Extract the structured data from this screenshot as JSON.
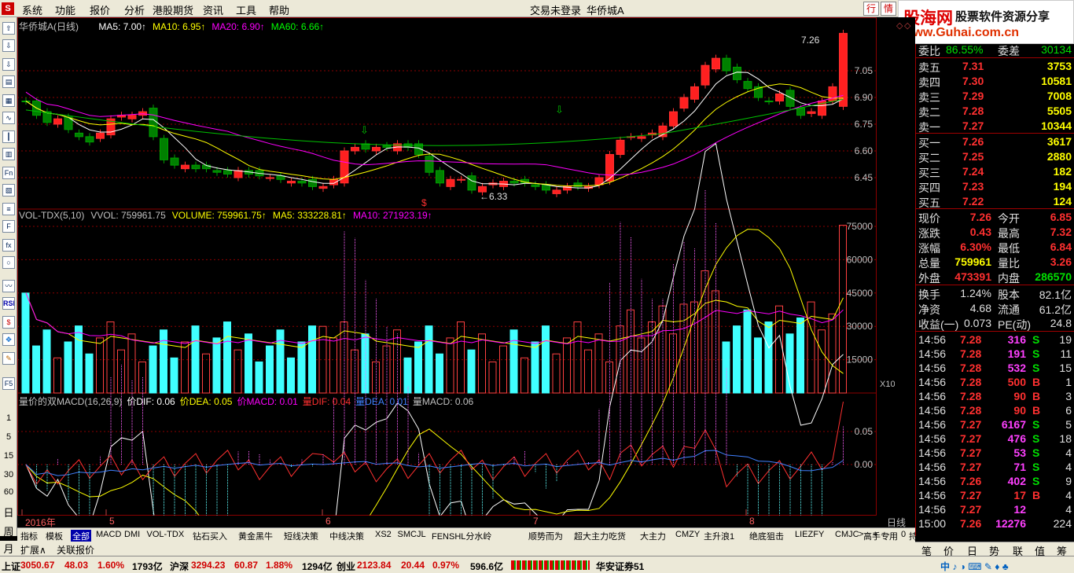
{
  "menu": {
    "items": [
      "系统",
      "功能",
      "报价",
      "分析",
      "港股期货",
      "资讯",
      "工具",
      "帮助"
    ],
    "trade_status": "交易未登录",
    "stock_title": "华侨城A",
    "btn_market": "行",
    "btn_info": "情"
  },
  "brand": {
    "name": "股海网",
    "slogan": "股票软件资源分享",
    "url": "www.Guhai.com.cn"
  },
  "toolbar": {
    "periods": [
      "1",
      "5",
      "15",
      "30",
      "60",
      "日",
      "周",
      "月"
    ],
    "rsi": "RSI",
    "fs": "F5"
  },
  "kline": {
    "title": "华侨城A(日线)",
    "ma_labels": [
      {
        "text": "MA5: 7.00",
        "color": "#ffffff"
      },
      {
        "text": "MA10: 6.95",
        "color": "#ffff00"
      },
      {
        "text": "MA20: 6.90",
        "color": "#ff00ff"
      },
      {
        "text": "MA60: 6.66",
        "color": "#00ff00"
      }
    ],
    "high_marker": "7.26",
    "low_marker": "6.33",
    "price_ticks": [
      "7.05",
      "6.90",
      "6.75",
      "6.60",
      "6.45"
    ]
  },
  "volume": {
    "labels": [
      {
        "text": "VOL-TDX(5,10)",
        "color": "#c0c0c0"
      },
      {
        "text": "VVOL: 759961.75",
        "color": "#c0c0c0"
      },
      {
        "text": "VOLUME: 759961.75",
        "color": "#ffff00"
      },
      {
        "text": "MA5: 333228.81",
        "color": "#ffff00"
      },
      {
        "text": "MA10: 271923.19",
        "color": "#ff00ff"
      }
    ],
    "ticks": [
      "75000",
      "60000",
      "45000",
      "30000",
      "15000"
    ],
    "unit": "X10"
  },
  "macd": {
    "labels": [
      {
        "text": "量价的双MACD(16,26,9)",
        "color": "#c0c0c0"
      },
      {
        "text": "价DIF: 0.06",
        "color": "#ffffff"
      },
      {
        "text": "价DEA: 0.05",
        "color": "#ffff00"
      },
      {
        "text": "价MACD: 0.01",
        "color": "#ff00ff"
      },
      {
        "text": "量DIF: 0.04",
        "color": "#ff3030"
      },
      {
        "text": "量DEA: 0.01",
        "color": "#4080ff"
      },
      {
        "text": "量MACD: 0.06",
        "color": "#c0c0c0"
      }
    ],
    "ticks": [
      "0.05",
      "0.00"
    ]
  },
  "date_axis": {
    "labels": [
      "2016年",
      "5",
      "6",
      "7",
      "8"
    ],
    "period": "日线"
  },
  "bottom_tabs": [
    "指标",
    "模板",
    "全部",
    "MACD",
    "DMI",
    "VOL-TDX",
    "钻石买入",
    "黄金黑牛",
    "短线决策",
    "中线决策",
    "XS2",
    "SMCJL",
    "FENSHL分水岭",
    "顺势而为",
    "超大主力吃货",
    "大主力",
    "CMZY",
    "主升浪1",
    "绝底狙击",
    "LIEZFY",
    "CMJC",
    "高手专用",
    "持仓线"
  ],
  "ext_tabs": [
    "扩展∧",
    "关联报价"
  ],
  "quote": {
    "committee": {
      "ratio_label": "委比",
      "ratio": "86.55%",
      "diff_label": "委差",
      "diff": "30134"
    },
    "asks": [
      {
        "label": "卖五",
        "price": "7.31",
        "vol": "3753"
      },
      {
        "label": "卖四",
        "price": "7.30",
        "vol": "10581"
      },
      {
        "label": "卖三",
        "price": "7.29",
        "vol": "7008"
      },
      {
        "label": "卖二",
        "price": "7.28",
        "vol": "5505"
      },
      {
        "label": "卖一",
        "price": "7.27",
        "vol": "10344"
      }
    ],
    "bids": [
      {
        "label": "买一",
        "price": "7.26",
        "vol": "3617"
      },
      {
        "label": "买二",
        "price": "7.25",
        "vol": "2880"
      },
      {
        "label": "买三",
        "price": "7.24",
        "vol": "182"
      },
      {
        "label": "买四",
        "price": "7.23",
        "vol": "194"
      },
      {
        "label": "买五",
        "price": "7.22",
        "vol": "124"
      }
    ],
    "stats": [
      {
        "l1": "现价",
        "v1": "7.26",
        "c1": "#ff3030",
        "l2": "今开",
        "v2": "6.85",
        "c2": "#ff3030"
      },
      {
        "l1": "涨跌",
        "v1": "0.43",
        "c1": "#ff3030",
        "l2": "最高",
        "v2": "7.32",
        "c2": "#ff3030"
      },
      {
        "l1": "涨幅",
        "v1": "6.30%",
        "c1": "#ff3030",
        "l2": "最低",
        "v2": "6.84",
        "c2": "#ff3030"
      },
      {
        "l1": "总量",
        "v1": "759961",
        "c1": "#ffff00",
        "l2": "量比",
        "v2": "3.26",
        "c2": "#ff3030"
      },
      {
        "l1": "外盘",
        "v1": "473391",
        "c1": "#ff3030",
        "l2": "内盘",
        "v2": "286570",
        "c2": "#00e000"
      }
    ],
    "stats2": [
      {
        "l1": "换手",
        "v1": "1.24%",
        "c1": "#e0e0e0",
        "l2": "股本",
        "v2": "82.1亿",
        "c2": "#e0e0e0"
      },
      {
        "l1": "净资",
        "v1": "4.68",
        "c1": "#e0e0e0",
        "l2": "流通",
        "v2": "61.2亿",
        "c2": "#e0e0e0"
      },
      {
        "l1": "收益(一)",
        "v1": "0.073",
        "c1": "#e0e0e0",
        "l2": "PE(动)",
        "v2": "24.8",
        "c2": "#e0e0e0"
      }
    ],
    "ticks": [
      {
        "t": "14:56",
        "p": "7.28",
        "v": "316",
        "bs": "S",
        "n": "19"
      },
      {
        "t": "14:56",
        "p": "7.28",
        "v": "191",
        "bs": "S",
        "n": "11"
      },
      {
        "t": "14:56",
        "p": "7.28",
        "v": "532",
        "bs": "S",
        "n": "15"
      },
      {
        "t": "14:56",
        "p": "7.28",
        "v": "500",
        "bs": "B",
        "n": "1"
      },
      {
        "t": "14:56",
        "p": "7.28",
        "v": "90",
        "bs": "B",
        "n": "3"
      },
      {
        "t": "14:56",
        "p": "7.28",
        "v": "90",
        "bs": "B",
        "n": "6"
      },
      {
        "t": "14:56",
        "p": "7.27",
        "v": "6167",
        "bs": "S",
        "n": "5"
      },
      {
        "t": "14:56",
        "p": "7.27",
        "v": "476",
        "bs": "S",
        "n": "18"
      },
      {
        "t": "14:56",
        "p": "7.27",
        "v": "53",
        "bs": "S",
        "n": "4"
      },
      {
        "t": "14:56",
        "p": "7.27",
        "v": "71",
        "bs": "S",
        "n": "4"
      },
      {
        "t": "14:56",
        "p": "7.26",
        "v": "402",
        "bs": "S",
        "n": "9"
      },
      {
        "t": "14:56",
        "p": "7.27",
        "v": "17",
        "bs": "B",
        "n": "4"
      },
      {
        "t": "14:56",
        "p": "7.27",
        "v": "12",
        "bs": "",
        "n": "4"
      },
      {
        "t": "15:00",
        "p": "7.26",
        "v": "12276",
        "bs": "",
        "n": "224"
      }
    ]
  },
  "panel_tabs": [
    "笔",
    "价",
    "日",
    "势",
    "联",
    "值",
    "筹"
  ],
  "statusbar": [
    {
      "text": "上证",
      "color": "#000"
    },
    {
      "text": "3050.67",
      "color": "#d00000"
    },
    {
      "text": "48.03",
      "color": "#d00000"
    },
    {
      "text": "1.60%",
      "color": "#d00000"
    },
    {
      "text": "1793亿",
      "color": "#000"
    },
    {
      "text": "沪深",
      "color": "#000"
    },
    {
      "text": "3294.23",
      "color": "#d00000"
    },
    {
      "text": "60.87",
      "color": "#d00000"
    },
    {
      "text": "1.88%",
      "color": "#d00000"
    },
    {
      "text": "1294亿",
      "color": "#000"
    },
    {
      "text": "创业",
      "color": "#000"
    },
    {
      "text": "2123.84",
      "color": "#d00000"
    },
    {
      "text": "20.44",
      "color": "#d00000"
    },
    {
      "text": "0.97%",
      "color": "#d00000"
    },
    {
      "text": "596.6亿",
      "color": "#000"
    },
    {
      "text": "华安证券51",
      "color": "#000"
    }
  ],
  "colors": {
    "up": "#ff3030",
    "down": "#00c0c0",
    "down_candle": "#008000",
    "grid": "#8b0000"
  }
}
